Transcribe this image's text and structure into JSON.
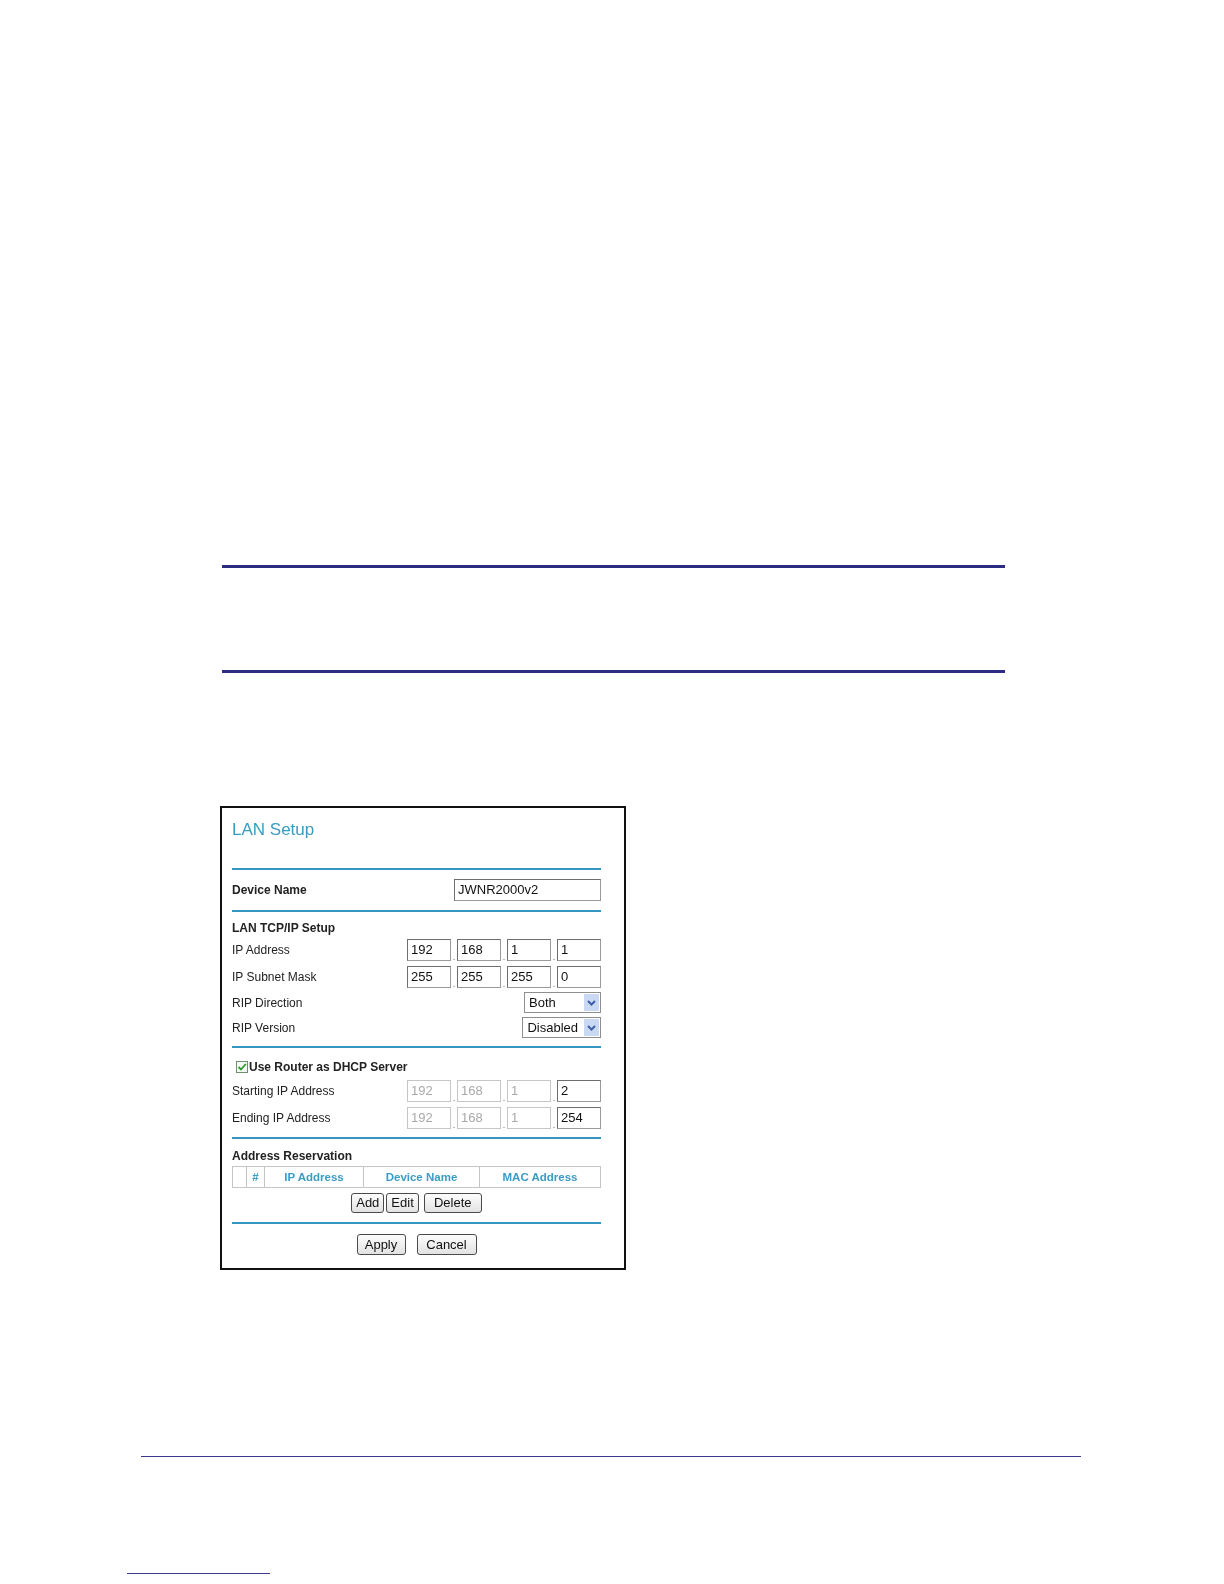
{
  "panel": {
    "title": "LAN Setup",
    "device_name": {
      "label": "Device Name",
      "value": "JWNR2000v2"
    },
    "tcp_ip": {
      "heading": "LAN TCP/IP Setup",
      "rows": [
        {
          "kind": "octets",
          "label": "IP Address",
          "octets": [
            {
              "value": "192",
              "disabled": false,
              "separator": "."
            },
            {
              "value": "168",
              "disabled": false,
              "separator": "."
            },
            {
              "value": "1",
              "disabled": false,
              "separator": "."
            },
            {
              "value": "1",
              "disabled": false
            }
          ]
        },
        {
          "kind": "octets",
          "label": "IP Subnet Mask",
          "octets": [
            {
              "value": "255",
              "disabled": false,
              "separator": "."
            },
            {
              "value": "255",
              "disabled": false,
              "separator": "."
            },
            {
              "value": "255",
              "disabled": false,
              "separator": "."
            },
            {
              "value": "0",
              "disabled": false
            }
          ]
        },
        {
          "kind": "select",
          "label": "RIP Direction",
          "value": "Both"
        },
        {
          "kind": "select",
          "label": "RIP Version",
          "value": "Disabled"
        }
      ]
    },
    "dhcp": {
      "label": "Use Router as DHCP Server",
      "checked": true,
      "rows": [
        {
          "label": "Starting IP Address",
          "octets": [
            {
              "value": "192",
              "disabled": true,
              "separator": "."
            },
            {
              "value": "168",
              "disabled": true,
              "separator": "."
            },
            {
              "value": "1",
              "disabled": true,
              "separator": "."
            },
            {
              "value": "2",
              "disabled": false
            }
          ]
        },
        {
          "label": "Ending IP Address",
          "octets": [
            {
              "value": "192",
              "disabled": true,
              "separator": "."
            },
            {
              "value": "168",
              "disabled": true,
              "separator": "."
            },
            {
              "value": "1",
              "disabled": true,
              "separator": "."
            },
            {
              "value": "254",
              "disabled": false
            }
          ]
        }
      ]
    },
    "reservation": {
      "heading": "Address Reservation",
      "columns": [
        "#",
        "IP Address",
        "Device Name",
        "MAC Address"
      ],
      "buttons": [
        "Add",
        "Edit",
        "Delete"
      ]
    },
    "actions": [
      "Apply",
      "Cancel"
    ]
  }
}
